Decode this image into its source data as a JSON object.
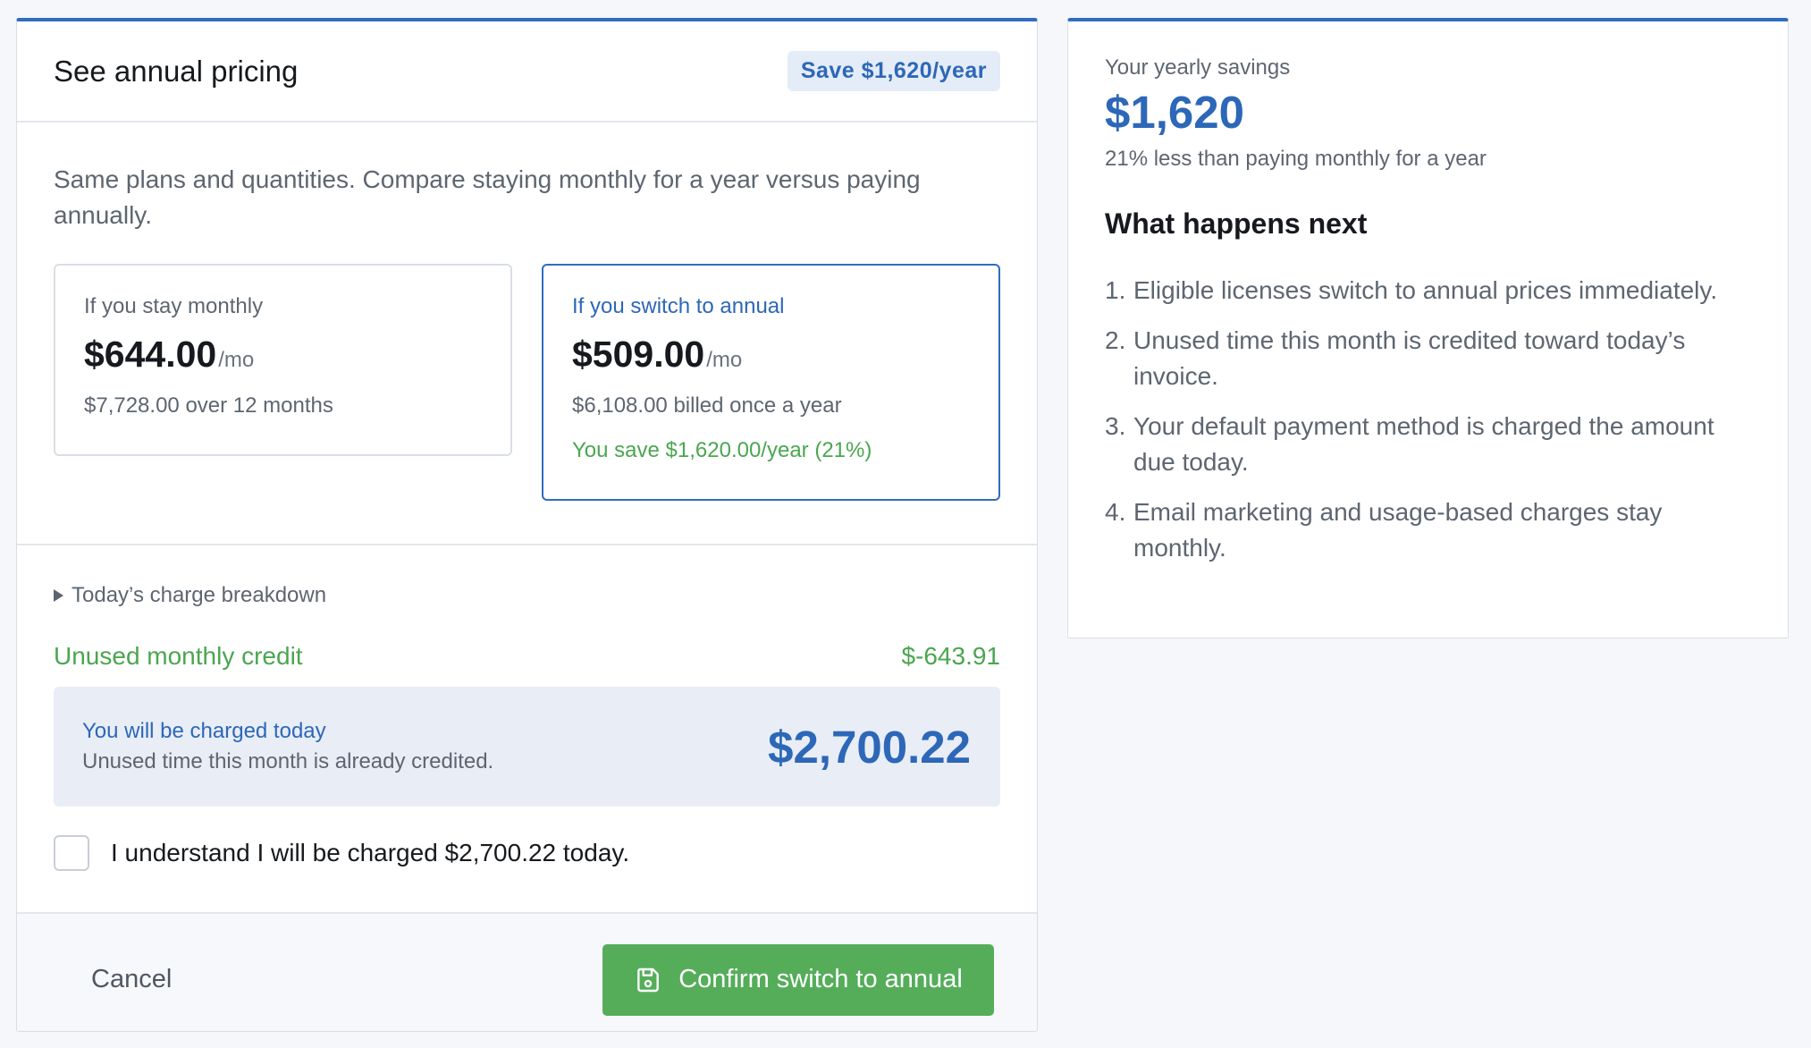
{
  "main_card": {
    "title": "See annual pricing",
    "badge": "Save $1,620/year",
    "intro": "Same plans and quantities. Compare staying monthly for a year versus paying annually.",
    "monthly_plan": {
      "label": "If you stay monthly",
      "price": "$644.00",
      "unit": "/mo",
      "sub": "$7,728.00 over 12 months"
    },
    "annual_plan": {
      "label": "If you switch to annual",
      "price": "$509.00",
      "unit": "/mo",
      "sub": "$6,108.00 billed once a year",
      "savings": "You save $1,620.00/year (21%)"
    },
    "breakdown": {
      "toggle_label": "Today’s charge breakdown",
      "credit_label": "Unused monthly credit",
      "credit_value": "$-643.91",
      "charge_title": "You will be charged today",
      "charge_sub": "Unused time this month is already credited.",
      "charge_amount": "$2,700.22"
    },
    "acknowledge_label": "I understand I will be charged $2,700.22 today.",
    "acknowledge_checked": false,
    "footer": {
      "cancel_label": "Cancel",
      "confirm_label": "Confirm switch to annual",
      "confirm_icon": "save-icon"
    }
  },
  "side_card": {
    "savings_label": "Your yearly savings",
    "savings_value": "$1,620",
    "savings_sub": "21% less than paying monthly for a year",
    "next_title": "What happens next",
    "steps": [
      {
        "num": "1.",
        "text": "Eligible licenses switch to annual prices immediately."
      },
      {
        "num": "2.",
        "text": "Unused time this month is credited toward today’s invoice."
      },
      {
        "num": "3.",
        "text": "Your default payment method is charged the amount due today."
      },
      {
        "num": "4.",
        "text": "Email marketing and usage-based charges stay monthly."
      }
    ]
  },
  "colors": {
    "accent_blue": "#2f6dc0",
    "success_green": "#4ba650",
    "confirm_button": "#55ad5a",
    "charge_box_bg": "#e8edf6"
  }
}
